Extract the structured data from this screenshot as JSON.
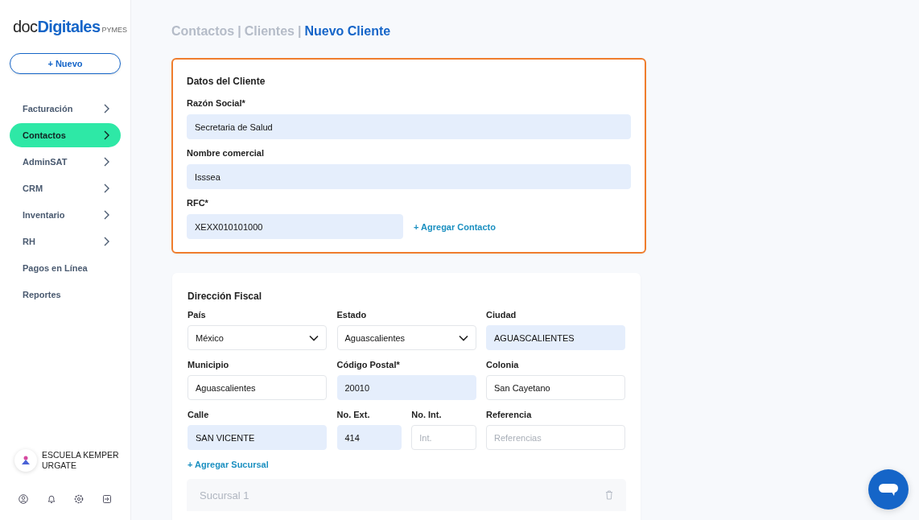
{
  "logo": {
    "main_light": "doc",
    "main_bold": "Digitales",
    "suffix": "PYMES"
  },
  "new_button": {
    "icon": "+",
    "label": "Nuevo"
  },
  "sidebar": {
    "items": [
      {
        "label": "Facturación",
        "selected": false,
        "has_submenu": true
      },
      {
        "label": "Contactos",
        "selected": true,
        "has_submenu": true
      },
      {
        "label": "AdminSAT",
        "selected": false,
        "has_submenu": true
      },
      {
        "label": "CRM",
        "selected": false,
        "has_submenu": true
      },
      {
        "label": "Inventario",
        "selected": false,
        "has_submenu": true
      },
      {
        "label": "RH",
        "selected": false,
        "has_submenu": true
      },
      {
        "label": "Pagos en Línea",
        "selected": false,
        "has_submenu": false
      },
      {
        "label": "Reportes",
        "selected": false,
        "has_submenu": false
      }
    ]
  },
  "account": {
    "name": "ESCUELA KEMPER URGATE"
  },
  "breadcrumb_separator": "|",
  "breadcrumb": [
    {
      "label": "Contactos",
      "selected": false
    },
    {
      "label": "Clientes",
      "selected": false
    },
    {
      "label": "Nuevo Cliente",
      "selected": true
    }
  ],
  "client_card": {
    "title": "Datos del Cliente",
    "highlighted": true,
    "fields": [
      {
        "label": "Razón Social*",
        "value": "Secretaria de Salud",
        "filled": true,
        "wide": true
      },
      {
        "label": "Nombre comercial",
        "value": "Isssea",
        "filled": true,
        "wide": true
      },
      {
        "label": "RFC*",
        "value": "XEXX010101000",
        "filled": true,
        "wide": false
      }
    ],
    "add_contact_link": "+ Agregar Contacto"
  },
  "address_card": {
    "title": "Dirección Fiscal",
    "highlighted": false,
    "fields": [
      {
        "label": "País",
        "kind": "select",
        "value": "México",
        "filled": false
      },
      {
        "label": "Estado",
        "kind": "select",
        "value": "Aguascalientes",
        "filled": false
      },
      {
        "label": "Ciudad",
        "kind": "text",
        "value": "AGUASCALIENTES",
        "filled": true
      },
      {
        "label": "Municipio",
        "kind": "text",
        "value": "Aguascalientes",
        "filled": false
      },
      {
        "label": "Código Postal*",
        "kind": "text",
        "value": "20010",
        "filled": true
      },
      {
        "label": "Colonia",
        "kind": "text",
        "value": "San Cayetano",
        "filled": false
      },
      {
        "label": "Calle",
        "kind": "text",
        "value": "SAN VICENTE",
        "filled": true
      },
      {
        "label": "No. Ext.",
        "kind": "short",
        "value": "414",
        "filled": true
      },
      {
        "label": "No. Int.",
        "kind": "short",
        "placeholder": "Int.",
        "filled": false
      },
      {
        "label": "Referencia",
        "kind": "text",
        "placeholder": "Referencias",
        "filled": false
      }
    ],
    "add_branch_link": "+ Agregar Sucursal",
    "branches": [
      {
        "title": "Sucursal 1"
      }
    ]
  }
}
